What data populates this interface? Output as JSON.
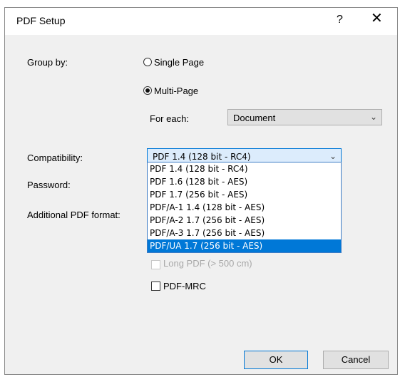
{
  "dialog": {
    "title": "PDF Setup",
    "help_label": "?",
    "close_label": "✕"
  },
  "group_by": {
    "label": "Group by:",
    "single_page": "Single Page",
    "multi_page": "Multi-Page",
    "selected": "Multi-Page",
    "for_each_label": "For each:",
    "for_each_value": "Document"
  },
  "compatibility": {
    "label": "Compatibility:",
    "selected": "PDF 1.4 (128 bit - RC4)",
    "options": [
      "PDF 1.4 (128 bit - RC4)",
      "PDF 1.6 (128 bit - AES)",
      "PDF 1.7 (256 bit - AES)",
      "PDF/A-1 1.4 (128 bit - AES)",
      "PDF/A-2 1.7 (256 bit - AES)",
      "PDF/A-3 1.7 (256 bit - AES)",
      "PDF/UA 1.7 (256 bit - AES)"
    ],
    "highlighted_index": 6
  },
  "password": {
    "label": "Password:"
  },
  "additional": {
    "label": "Additional PDF format:",
    "long_pdf": "Long PDF (> 500 cm)",
    "pdf_mrc": "PDF-MRC"
  },
  "buttons": {
    "ok": "OK",
    "cancel": "Cancel"
  },
  "icons": {
    "dropdown": "chevron-down-icon",
    "close": "close-icon",
    "help": "help-icon"
  }
}
